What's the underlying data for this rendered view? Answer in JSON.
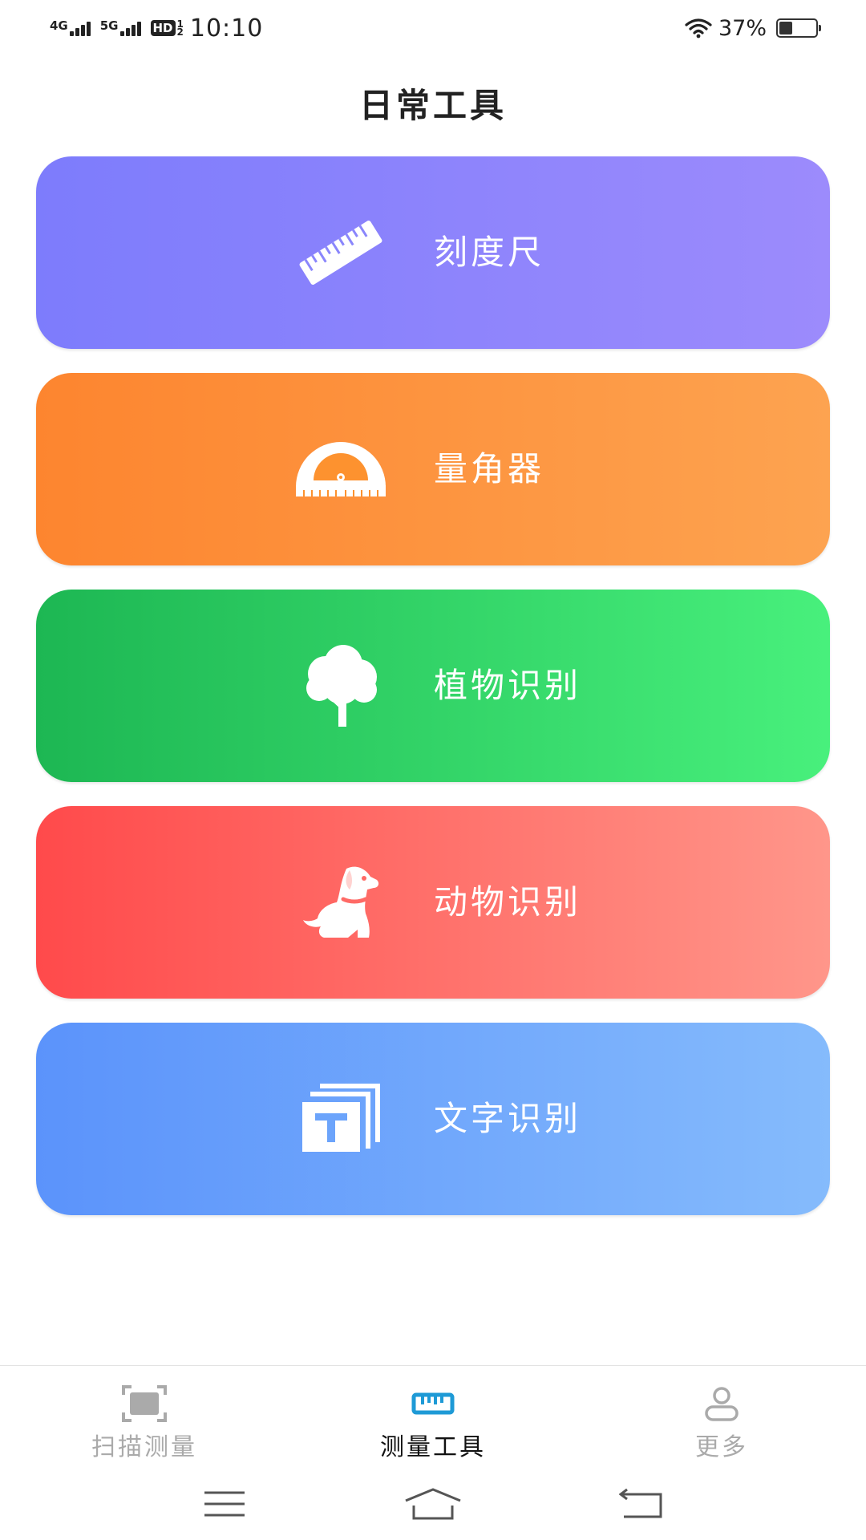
{
  "status_bar": {
    "network_1": "4G",
    "network_2": "5G",
    "hd": "HD",
    "hd_sub_1": "1",
    "hd_sub_2": "2",
    "time": "10:10",
    "battery_percent": "37%",
    "battery_level": 0.37
  },
  "page": {
    "title": "日常工具"
  },
  "tools": [
    {
      "label": "刻度尺",
      "icon": "ruler-icon",
      "color_start": "#7d7cfc",
      "color_end": "#9c8bfc"
    },
    {
      "label": "量角器",
      "icon": "protractor-icon",
      "color_start": "#fd852f",
      "color_end": "#fda350"
    },
    {
      "label": "植物识别",
      "icon": "tree-icon",
      "color_start": "#1db753",
      "color_end": "#48f07c"
    },
    {
      "label": "动物识别",
      "icon": "dog-icon",
      "color_start": "#ff4a4b",
      "color_end": "#ff968a"
    },
    {
      "label": "文字识别",
      "icon": "text-recognition-icon",
      "color_start": "#5b93fb",
      "color_end": "#85bbfc"
    }
  ],
  "bottom_nav": {
    "items": [
      {
        "label": "扫描测量",
        "icon": "scan-icon",
        "active": false
      },
      {
        "label": "测量工具",
        "icon": "ruler-tab-icon",
        "active": true
      },
      {
        "label": "更多",
        "icon": "user-icon",
        "active": false
      }
    ],
    "active_color": "#1e9ad6",
    "inactive_color": "#aaaaaa"
  },
  "system_nav": {
    "buttons": [
      "menu-icon",
      "home-icon",
      "back-icon"
    ]
  }
}
